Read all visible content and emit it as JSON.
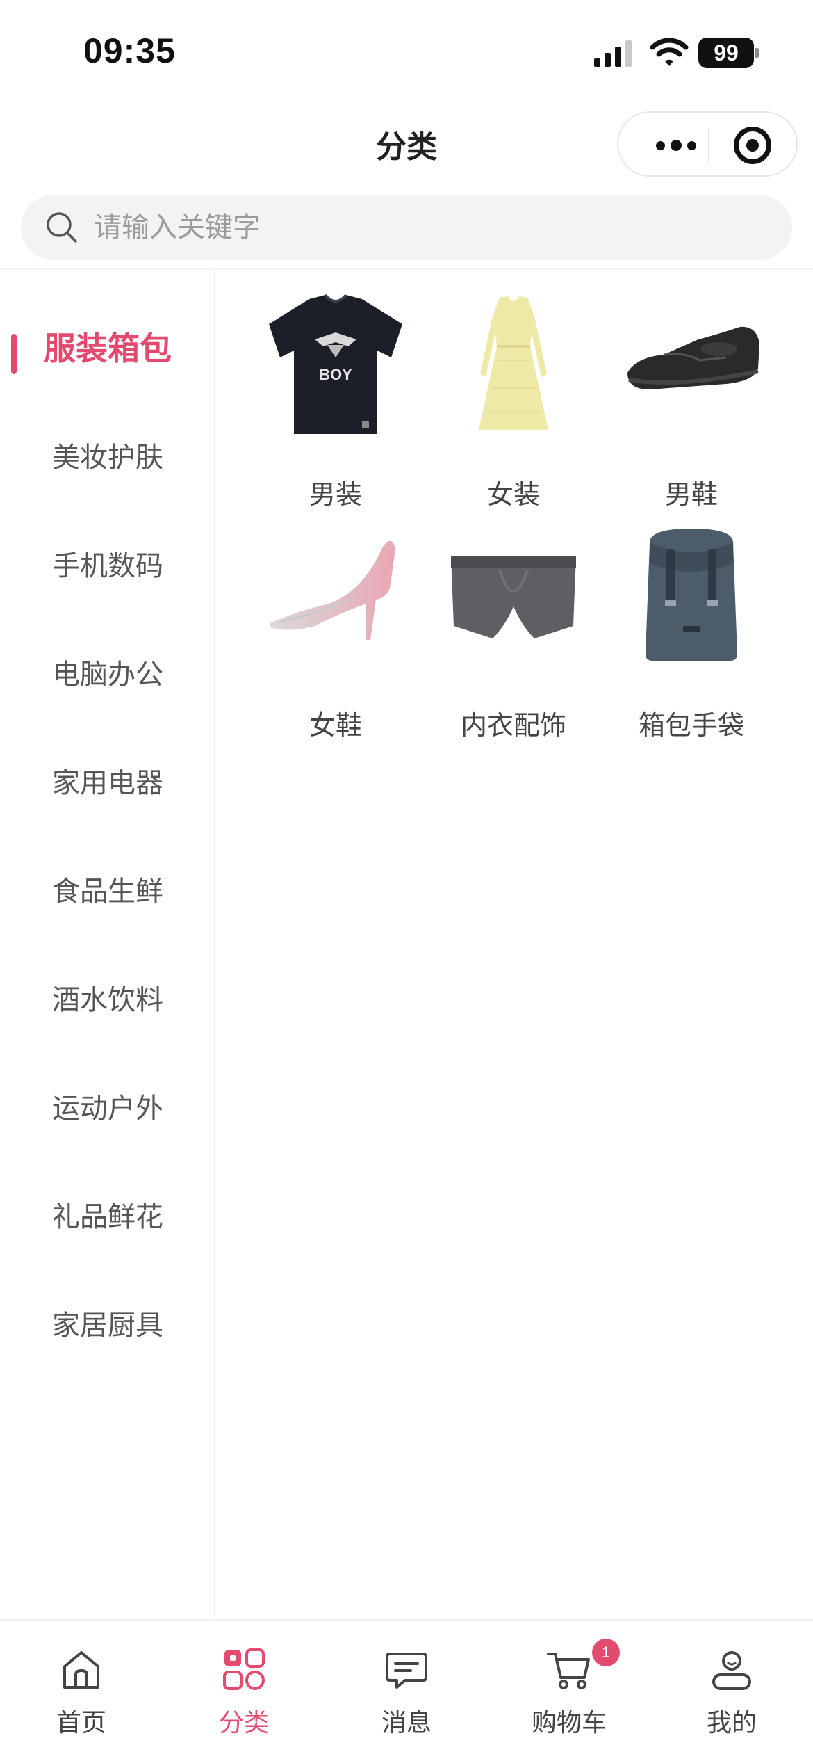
{
  "status_bar": {
    "time": "09:35",
    "battery": "99"
  },
  "nav": {
    "title": "分类"
  },
  "search": {
    "placeholder": "请输入关键字"
  },
  "sidebar": {
    "items": [
      {
        "label": "服装箱包",
        "active": true
      },
      {
        "label": "美妆护肤"
      },
      {
        "label": "手机数码"
      },
      {
        "label": "电脑办公"
      },
      {
        "label": "家用电器"
      },
      {
        "label": "食品生鲜"
      },
      {
        "label": "酒水饮料"
      },
      {
        "label": "运动户外"
      },
      {
        "label": "礼品鲜花"
      },
      {
        "label": "家居厨具"
      }
    ]
  },
  "categories": [
    {
      "label": "男装",
      "icon": "tshirt-image"
    },
    {
      "label": "女装",
      "icon": "dress-image"
    },
    {
      "label": "男鞋",
      "icon": "mens-shoe-image"
    },
    {
      "label": "女鞋",
      "icon": "high-heel-image"
    },
    {
      "label": "内衣配饰",
      "icon": "underwear-image"
    },
    {
      "label": "箱包手袋",
      "icon": "backpack-image"
    }
  ],
  "tabbar": {
    "items": [
      {
        "label": "首页",
        "icon": "home-icon"
      },
      {
        "label": "分类",
        "icon": "category-icon",
        "active": true
      },
      {
        "label": "消息",
        "icon": "message-icon"
      },
      {
        "label": "购物车",
        "icon": "cart-icon",
        "badge": "1"
      },
      {
        "label": "我的",
        "icon": "profile-icon"
      }
    ]
  },
  "colors": {
    "accent": "#e24a6e",
    "text": "#444444",
    "search_bg": "#f3f3f3"
  }
}
